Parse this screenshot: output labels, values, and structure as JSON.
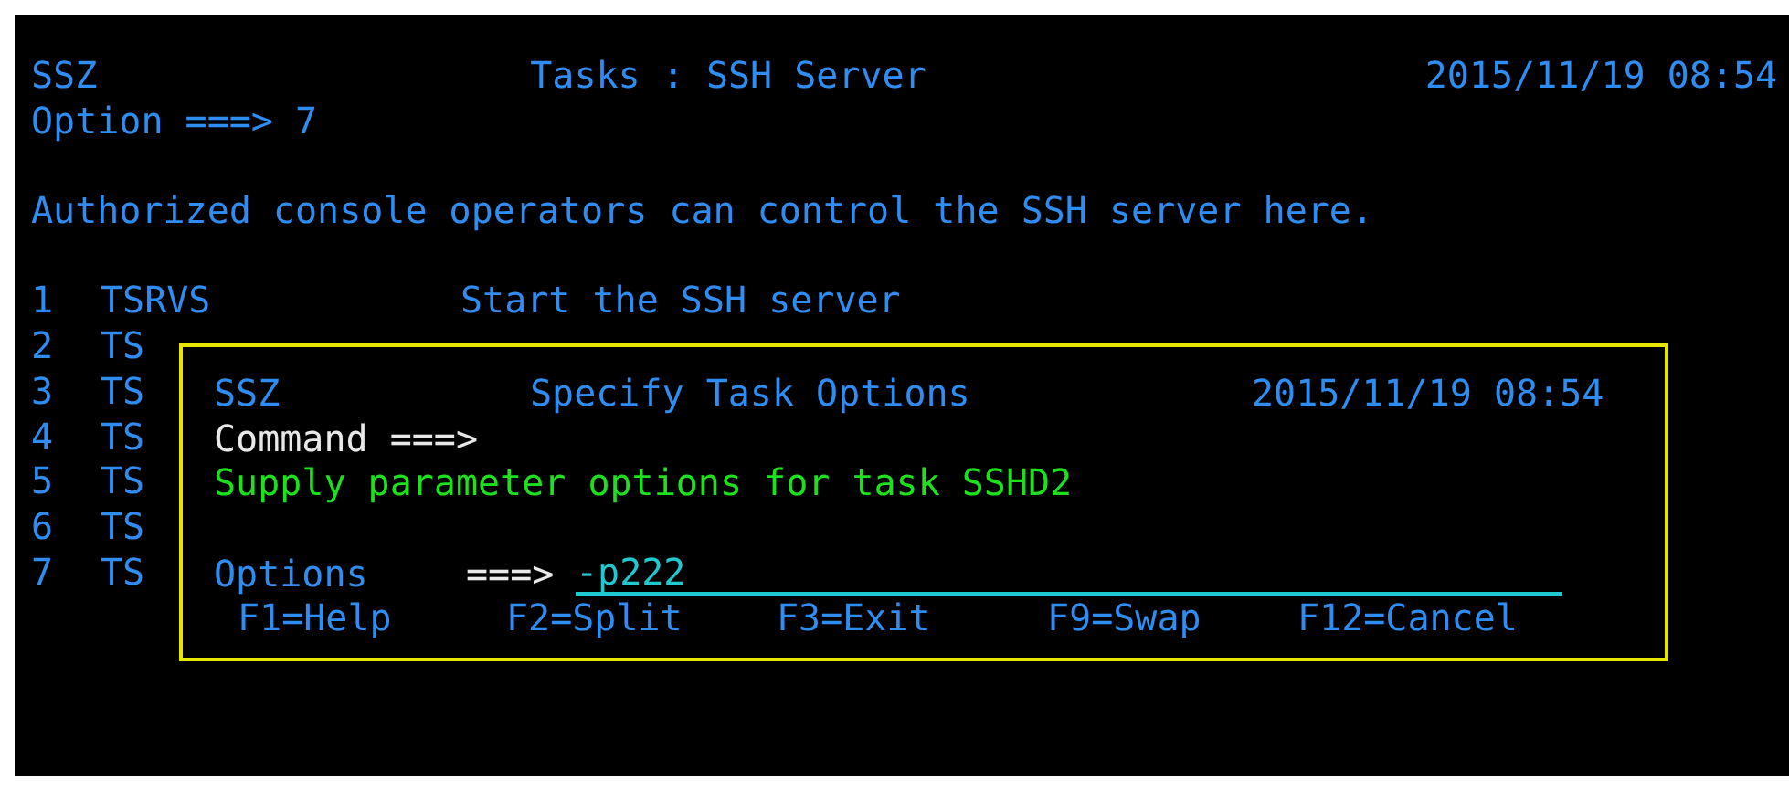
{
  "header": {
    "system": "SSZ",
    "title": "Tasks : SSH Server",
    "datetime": "2015/11/19 08:54"
  },
  "option_line": {
    "label": "Option ===>",
    "value": "7"
  },
  "message": "Authorized console operators can control the SSH server here.",
  "menu_items": [
    {
      "number": "1",
      "name": "TSRVS",
      "description": "Start the SSH server"
    },
    {
      "number": "2",
      "name": "TS"
    },
    {
      "number": "3",
      "name": "TS"
    },
    {
      "number": "4",
      "name": "TS"
    },
    {
      "number": "5",
      "name": "TS"
    },
    {
      "number": "6",
      "name": "TS"
    },
    {
      "number": "7",
      "name": "TS"
    }
  ],
  "popup": {
    "system": "SSZ",
    "title": "Specify Task Options",
    "datetime": "2015/11/19 08:54",
    "command_label": "Command ===>",
    "message": "Supply parameter options for task SSHD2",
    "options_label": "Options",
    "options_arrow": "===>",
    "options_value": "-p222",
    "function_keys": [
      "F1=Help",
      "F2=Split",
      "F3=Exit",
      "F9=Swap",
      "F12=Cancel"
    ]
  }
}
